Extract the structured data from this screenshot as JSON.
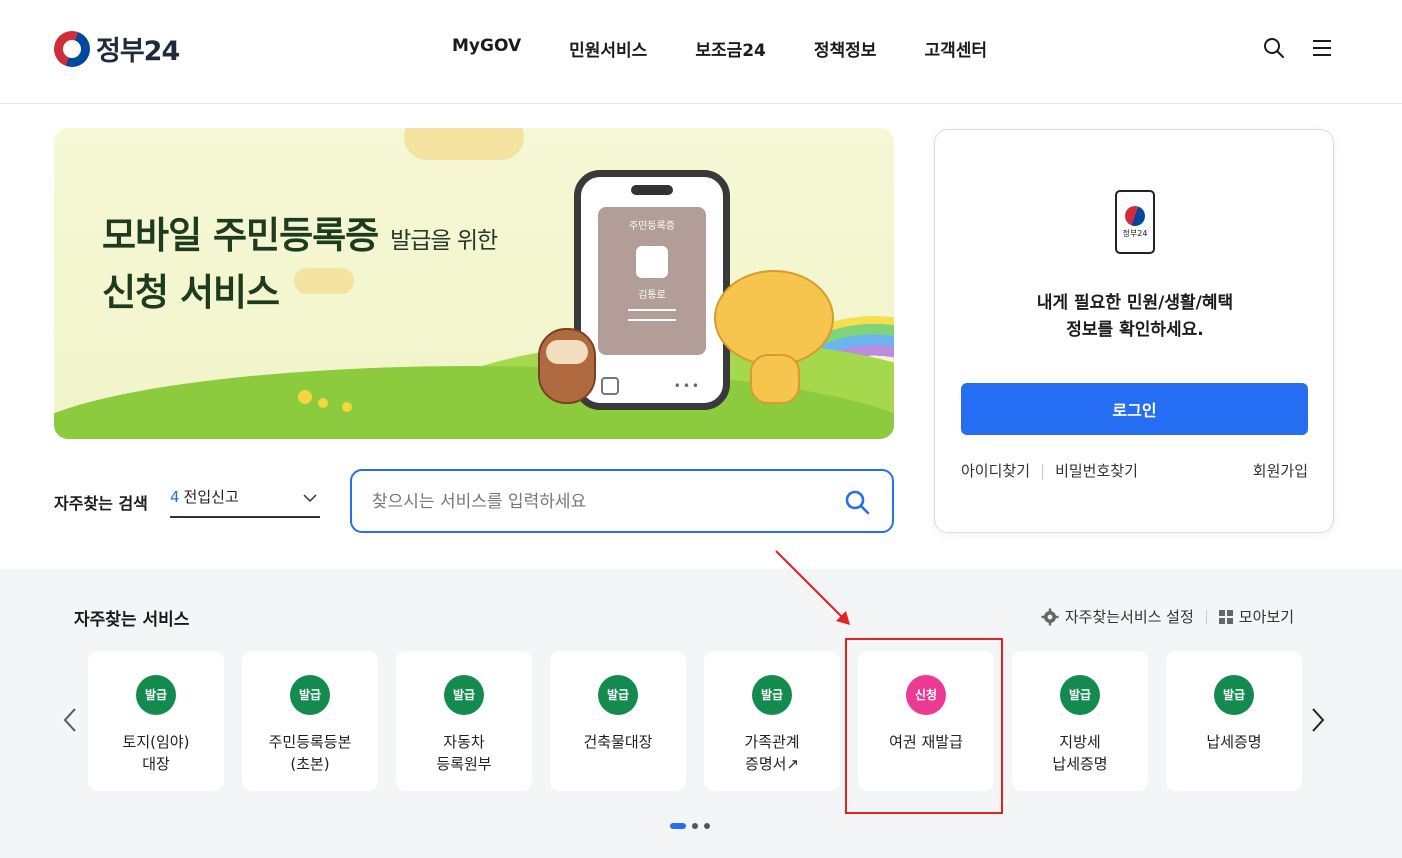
{
  "header": {
    "logo_text": "정부24",
    "nav": [
      "MyGOV",
      "민원서비스",
      "보조금24",
      "정책정보",
      "고객센터"
    ]
  },
  "banner": {
    "title_line1": "모바일 주민등록증",
    "title_small": "발급을 위한",
    "title_line2": "신청 서비스",
    "card_title": "주민등록증",
    "card_name": "김통로"
  },
  "search": {
    "label": "자주찾는 검색",
    "select_number": "4",
    "select_keyword": "전입신고",
    "placeholder": "찾으시는 서비스를 입력하세요"
  },
  "login": {
    "phone_label": "정부24",
    "message_line1": "내게 필요한 민원/생활/혜택",
    "message_line2": "정보를 확인하세요.",
    "button": "로그인",
    "find_id": "아이디찾기",
    "find_pw": "비밀번호찾기",
    "signup": "회원가입"
  },
  "favorites": {
    "title": "자주찾는 서비스",
    "settings": "자주찾는서비스 설정",
    "view_all": "모아보기",
    "cards": [
      {
        "badge": "발급",
        "label": "토지(임야)\n대장",
        "color": "#138a4e"
      },
      {
        "badge": "발급",
        "label": "주민등록등본\n(초본)",
        "color": "#138a4e"
      },
      {
        "badge": "발급",
        "label": "자동차\n등록원부",
        "color": "#138a4e"
      },
      {
        "badge": "발급",
        "label": "건축물대장",
        "color": "#138a4e"
      },
      {
        "badge": "발급",
        "label": "가족관계\n증명서↗",
        "color": "#138a4e"
      },
      {
        "badge": "신청",
        "label": "여권 재발급",
        "color": "#ec3a94"
      },
      {
        "badge": "발급",
        "label": "지방세\n납세증명",
        "color": "#138a4e"
      },
      {
        "badge": "발급",
        "label": "납세증명",
        "color": "#138a4e"
      }
    ]
  },
  "colors": {
    "primary": "#256ef4",
    "badge_green": "#138a4e",
    "badge_pink": "#ec3a94",
    "highlight": "#e52121"
  }
}
